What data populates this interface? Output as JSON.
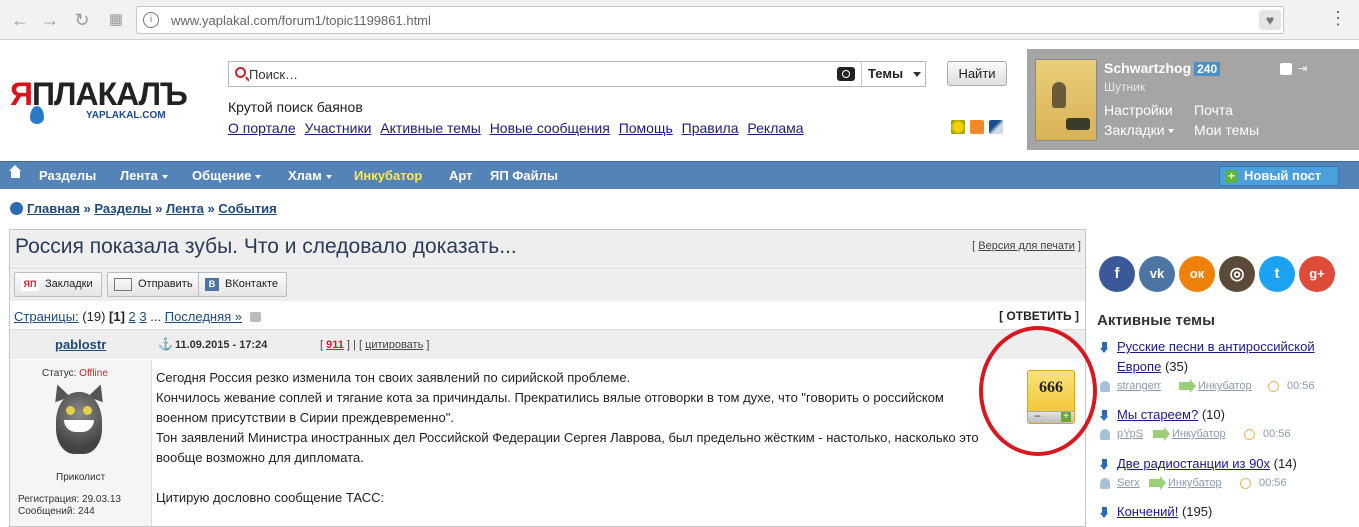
{
  "browser": {
    "url_domain": "www.yaplakal.com",
    "url_path": "/forum1/topic1199861.html",
    "back_icon": "arrow-left-icon",
    "forward_icon": "arrow-right-icon",
    "reload_icon": "reload-icon",
    "apps_icon": "apps-grid-icon",
    "page_icon": "page-info-icon",
    "bookmark_icon": "heart-icon",
    "menu_icon": "menu-icon"
  },
  "header": {
    "logo_text_red": "Я",
    "logo_text_dark": "ПЛАКАЛЪ",
    "logo_domain": "YAPLAKAL.COM",
    "search_placeholder": "Поиск…",
    "search_scope": "Темы",
    "search_button": "Найти",
    "tagline": "Крутой поиск баянов",
    "links": [
      "О портале",
      "Участники",
      "Активные темы",
      "Новые сообщения",
      "Помощь",
      "Правила",
      "Реклама"
    ]
  },
  "user": {
    "name": "Schwartzhog",
    "karma": "240",
    "rank": "Шутник",
    "settings": "Настройки",
    "mail": "Почта",
    "bookmarks": "Закладки",
    "my_topics": "Мои темы"
  },
  "nav": {
    "items": [
      "Разделы",
      "Лента",
      "Общение",
      "Хлам",
      "Инкубатор",
      "Арт",
      "ЯП Файлы"
    ],
    "new_post": "Новый пост"
  },
  "breadcrumb": {
    "items": [
      "Главная",
      "Разделы",
      "Лента",
      "События"
    ],
    "separator": "»"
  },
  "topic": {
    "title": "Россия показала зубы. Что и следовало доказать...",
    "print_label": "Версия для печати",
    "buttons": {
      "bookmarks": "Закладки",
      "send": "Отправить",
      "vk": "ВКонтакте",
      "yap_badge": "ЯП",
      "vk_badge": "B"
    },
    "pages_label": "Страницы:",
    "pages_total": "(19)",
    "pages_current": "[1]",
    "pages": [
      "2",
      "3"
    ],
    "pages_ellipsis": "...",
    "pages_last": "Последняя »",
    "reply": "[ ОТВЕТИТЬ ]"
  },
  "post": {
    "author": "pablostr",
    "date": "11.09.2015 - 17:24",
    "number": "911",
    "quote": "цитировать",
    "status_label": "Статус:",
    "status_value": "Offline",
    "role": "Приколист",
    "registered": "Регистрация: 29.03.13",
    "messages": "Сообщений: 244",
    "rating": "666",
    "rating_minus": "−",
    "rating_plus": "+",
    "paragraphs": [
      "Сегодня Россия резко изменила тон своих заявлений по сирийской проблеме.",
      "Кончилось жевание соплей и тягание кота за причиндалы. Прекратились вялые отговорки в том духе, что \"говорить о российском военном присутствии в Сирии преждевременно\".",
      "Тон заявлений Министра иностранных дел Российской Федерации Сергея Лаврова, был предельно жёстким - настолько, насколько это вообще возможно для дипломата.",
      "",
      "Цитирую дословно сообщение ТАСС:"
    ]
  },
  "sidebar": {
    "social": [
      {
        "name": "facebook",
        "glyph": "f",
        "color": "#3b5998"
      },
      {
        "name": "vk",
        "glyph": "vk",
        "color": "#4c75a3"
      },
      {
        "name": "odnoklassniki",
        "glyph": "ок",
        "color": "#ee8208"
      },
      {
        "name": "instagram",
        "glyph": "◎",
        "color": "#5b4a3a"
      },
      {
        "name": "twitter",
        "glyph": "t",
        "color": "#1da1f2"
      },
      {
        "name": "google-plus",
        "glyph": "g+",
        "color": "#dd4b39"
      }
    ],
    "active_title": "Активные темы",
    "active": [
      {
        "title": "Русские песни в антироссийской Европе",
        "line1": "Русские песни в антироссийской",
        "line2": "Европе",
        "count": "(35)",
        "user": "strangerr",
        "section": "Инкубатор",
        "time": "00:56"
      },
      {
        "title": "Мы стареем?",
        "count": "(10)",
        "user": "pYpS",
        "section": "Инкубатор",
        "time": "00:56"
      },
      {
        "title": "Две радиостанции из 90х",
        "count": "(14)",
        "user": "Serx",
        "section": "Инкубатор",
        "time": "00:56"
      },
      {
        "title": "Кончений!",
        "count": "(195)"
      }
    ]
  },
  "colors": {
    "nav_bg": "#5483b8",
    "accent_red": "#d81820",
    "link": "#1a1a8a",
    "user_panel": "#a5a5a5",
    "rating_bg": "#efc22a"
  }
}
